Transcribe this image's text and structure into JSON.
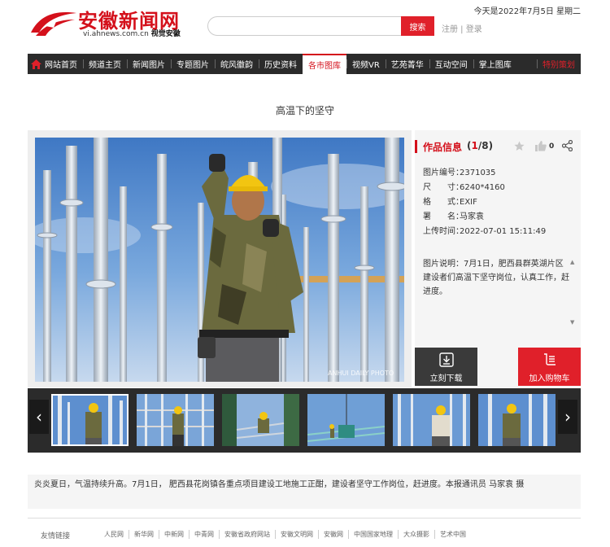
{
  "header": {
    "logo_text": "安徽新闻网",
    "logo_url": "vi.ahnews.com.cn",
    "logo_sub": "视觉安徽",
    "search_placeholder": "",
    "search_button": "搜索",
    "login": "注册",
    "register": "登录",
    "date": "今天是2022年7月5日 星期二"
  },
  "nav": {
    "items": [
      "网站首页",
      "频道主页",
      "新闻图片",
      "专题图片",
      "皖风徽韵",
      "历史资料",
      "各市图库",
      "视频VR",
      "艺苑菁华",
      "互动空间",
      "掌上图库"
    ],
    "special": "特别策划",
    "active": "各市图库"
  },
  "photo": {
    "title": "高温下的坚守",
    "watermark": "ANHUI DAILY PHOTO"
  },
  "info": {
    "heading": "作品信息",
    "current": "1",
    "total": "/8",
    "like_count": "0",
    "rows": [
      {
        "key": "图片编号：",
        "value": "2371035"
      },
      {
        "key": "尺　　寸：",
        "value": "6240*4160"
      },
      {
        "key": "格　　式：",
        "value": "EXIF"
      },
      {
        "key": "署　　名：",
        "value": "马家袁"
      },
      {
        "key": "上传时间：",
        "value": "2022-07-01 15:11:49"
      }
    ],
    "description": "图片说明：7月1日，肥西县群英湖片区建设者们高温下坚守岗位，认真工作，赶进度。",
    "download_label": "立刻下载",
    "cart_label": "加入购物车"
  },
  "caption": "炎炎夏日，气温持续升高。7月1日， 肥西县花岗镇各重点项目建设工地施工正酣，建设者坚守工作岗位，赶进度。本报通讯员 马家袁 摄",
  "links": {
    "label": "友情链接",
    "items": [
      "人民网",
      "新华网",
      "中新网",
      "中青网",
      "安徽省政府网站",
      "安徽文明网",
      "安徽网",
      "中国国家地理",
      "大众摄影",
      "艺术中国"
    ]
  },
  "colors": {
    "brand_red": "#d4101b",
    "nav_bg": "#2b2b2b",
    "button_red": "#e0202a"
  }
}
